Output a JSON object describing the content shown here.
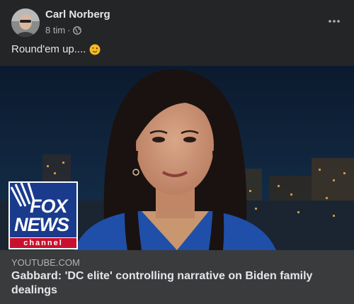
{
  "post": {
    "author": "Carl Norberg",
    "time": "8 tim",
    "separator": "·",
    "privacy_icon": "globe-icon",
    "more_icon": "more-horizontal-icon",
    "caption": "Round'em up....",
    "caption_emoji": "winking-face-emoji"
  },
  "link_preview": {
    "domain": "YOUTUBE.COM",
    "title": "Gabbard: 'DC elite' controlling narrative on Biden family dealings",
    "thumbnail_logo": {
      "line1": "FOX",
      "line2": "NEWS",
      "line3": "channel"
    }
  },
  "colors": {
    "background": "#242526",
    "link_box": "#3a3b3c",
    "text_primary": "#e4e6eb",
    "text_secondary": "#b0b3b8",
    "fox_blue": "#1a3a8c",
    "fox_red": "#c8102e"
  }
}
